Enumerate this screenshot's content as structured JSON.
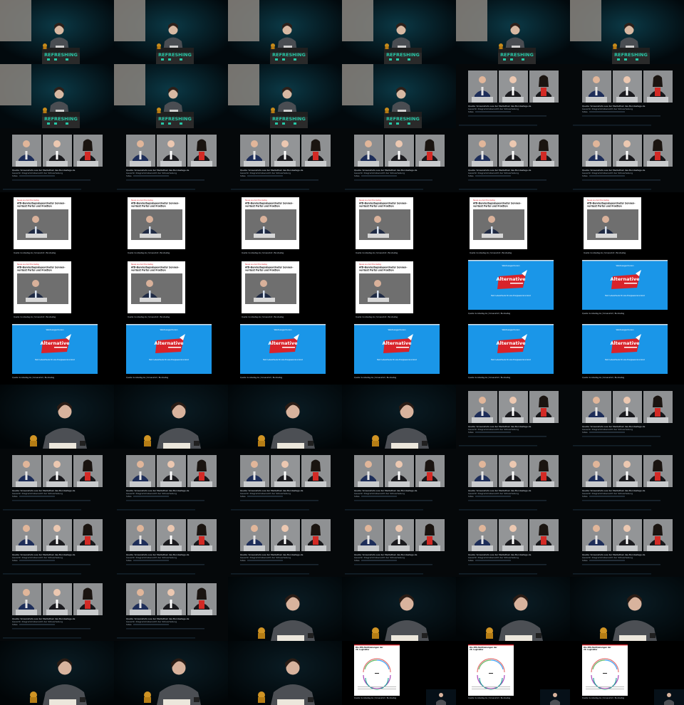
{
  "sheet": {
    "columns": 6,
    "rows": 11
  },
  "texts": {
    "refreshing": "REFRESHING",
    "article_kicker": "Neues aus dem Bundestag",
    "article_headline_1": "AfD-Bundestagsabgeordneter Sonnen-",
    "article_headline_2": "verlässt Partei und Fraktion",
    "blue_top": "Werbeagenturen",
    "logo_text": "Alternative",
    "blue_bottom": "Mehr Lebensfreude für eine Energiewende konkret",
    "caption": "Quelle: bundestag.de | Screenshot / Bundestag",
    "desc_1": "Quelle: Screenshots aus der Mediathek des Bundestags.de",
    "desc_2": "Gesamt: Diagrammübersicht der Sitzverteilung",
    "desc_3": "Sitze:",
    "chart_title_1": "Die AfD-Abstimmungen der",
    "chart_title_2": "20. Legislatur"
  },
  "colors": {
    "stage_bg": "#06141c",
    "blue_bg": "#1a96e8",
    "logo_red": "#d8232a",
    "article_red": "#d8232a",
    "screen_teal": "#27c7a6",
    "podium": "#2a2a2a"
  },
  "cells": [
    "stage",
    "stage",
    "stage",
    "stage",
    "stage",
    "stage",
    "stage",
    "stage",
    "stage",
    "stage",
    "panel",
    "panel",
    "panel",
    "panel",
    "panel",
    "panel",
    "panel",
    "panel",
    "article",
    "article",
    "article",
    "article",
    "article",
    "article",
    "article",
    "article",
    "article",
    "article",
    "blue",
    "blue",
    "blue",
    "blue",
    "blue",
    "blue",
    "blue",
    "blue",
    "close",
    "close",
    "close",
    "close",
    "panel",
    "panel",
    "panel",
    "panel",
    "panel",
    "panel",
    "panel",
    "panel",
    "panel",
    "panel",
    "panel",
    "panel",
    "panel",
    "panel",
    "panel",
    "panel",
    "close",
    "close",
    "close",
    "close",
    "close",
    "close",
    "close",
    "chart",
    "chart",
    "chart"
  ]
}
